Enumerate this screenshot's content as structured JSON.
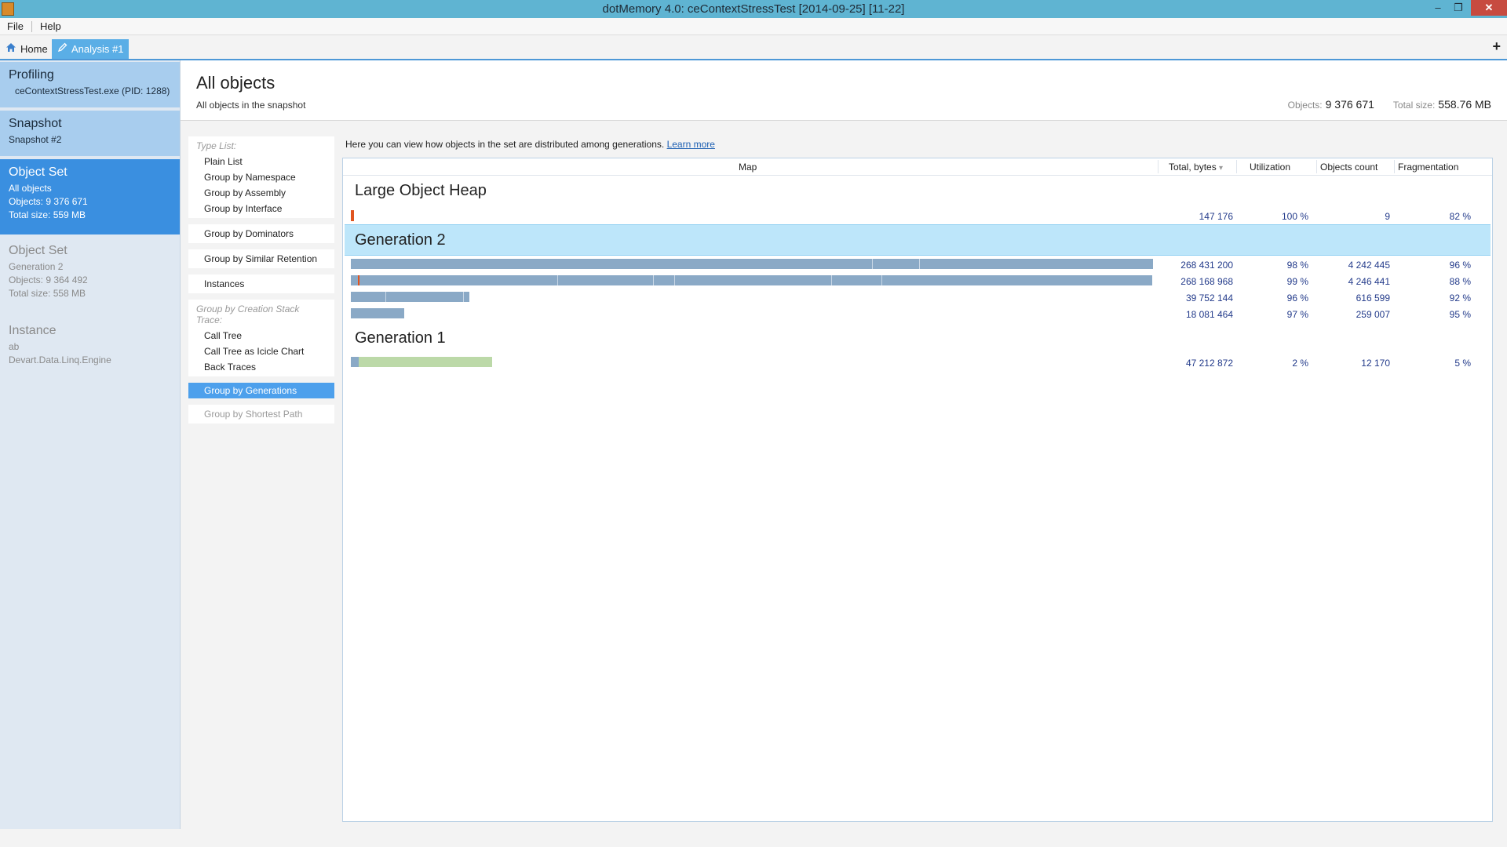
{
  "window": {
    "title": "dotMemory 4.0:  ceContextStressTest [2014-09-25] [11-22]",
    "min_glyph": "–",
    "max_glyph": "❐",
    "close_glyph": "✕"
  },
  "menu": {
    "file": "File",
    "help": "Help"
  },
  "tabs": {
    "home": "Home",
    "analysis": "Analysis #1",
    "add": "+"
  },
  "sidebar": {
    "profiling": {
      "title": "Profiling",
      "detail": "ceContextStressTest.exe (PID: 1288)"
    },
    "snapshot": {
      "title": "Snapshot",
      "detail": "Snapshot #2"
    },
    "object_set_active": {
      "title": "Object Set",
      "name": "All objects",
      "objects": "Objects: 9 376 671",
      "size": "Total size: 559 MB"
    },
    "object_set_inactive": {
      "title": "Object Set",
      "name": "Generation 2",
      "objects": "Objects: 9 364 492",
      "size": "Total size: 558 MB"
    },
    "instance": {
      "title": "Instance",
      "name": "ab",
      "type": "Devart.Data.Linq.Engine"
    }
  },
  "content": {
    "title": "All objects",
    "subtitle": "All objects in the snapshot",
    "objects_label": "Objects:",
    "objects_value": "9 376 671",
    "size_label": "Total size:",
    "size_value": "558.76 MB"
  },
  "views": {
    "type_list_label": "Type List:",
    "plain_list": "Plain List",
    "group_namespace": "Group by Namespace",
    "group_assembly": "Group by Assembly",
    "group_interface": "Group by Interface",
    "group_dominators": "Group by Dominators",
    "group_similar": "Group by Similar Retention",
    "instances": "Instances",
    "creation_label": "Group by Creation Stack Trace:",
    "call_tree": "Call Tree",
    "call_tree_icicle": "Call Tree as Icicle Chart",
    "back_traces": "Back Traces",
    "group_generations": "Group by Generations",
    "group_shortest": "Group by Shortest Path"
  },
  "info": {
    "text": "Here you can view how objects in the set are distributed among generations.",
    "link": "Learn more"
  },
  "grid": {
    "columns": {
      "map": "Map",
      "total_bytes": "Total, bytes",
      "sort_glyph": "▾",
      "utilization": "Utilization",
      "objects_count": "Objects count",
      "fragmentation": "Fragmentation"
    },
    "sections": {
      "loh": "Large Object Heap",
      "gen2": "Generation 2",
      "gen1": "Generation 1"
    },
    "rows": [
      {
        "section": "loh",
        "total": "147 176",
        "util": "100 %",
        "count": "9",
        "frag": "82 %",
        "fill": 0.004
      },
      {
        "section": "gen2",
        "total": "268 431 200",
        "util": "98 %",
        "count": "4 242 445",
        "frag": "96 %",
        "fill": 1.0
      },
      {
        "section": "gen2",
        "total": "268 168 968",
        "util": "99 %",
        "count": "4 246 441",
        "frag": "88 %",
        "fill": 0.999
      },
      {
        "section": "gen2",
        "total": "39 752 144",
        "util": "96 %",
        "count": "616 599",
        "frag": "92 %",
        "fill": 0.148
      },
      {
        "section": "gen2",
        "total": "18 081 464",
        "util": "97 %",
        "count": "259 007",
        "frag": "95 %",
        "fill": 0.067
      },
      {
        "section": "gen1",
        "total": "47 212 872",
        "util": "2 %",
        "count": "12 170",
        "frag": "5 %",
        "fill": 0.176
      }
    ]
  },
  "colors": {
    "titlebar": "#5fb4d2",
    "accent": "#3a8fe0",
    "bar": "#8aa9c6",
    "gen1_bar": "#bcd9a8",
    "loh_bar": "#e0541f"
  }
}
